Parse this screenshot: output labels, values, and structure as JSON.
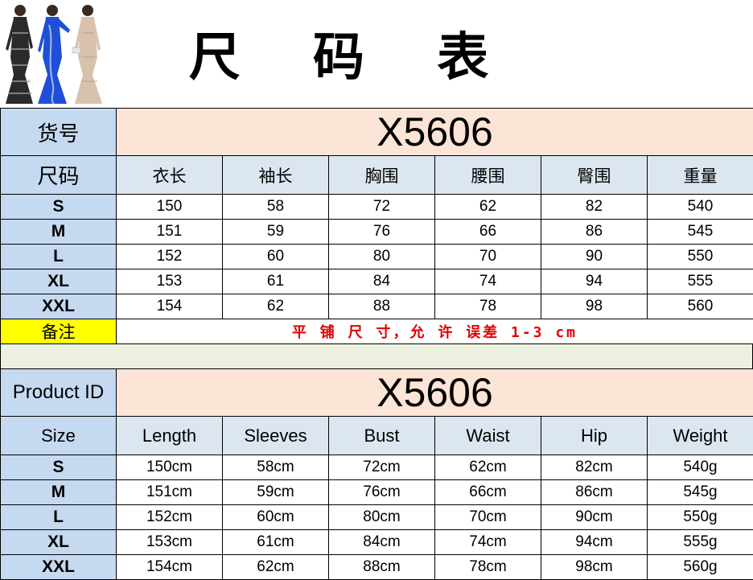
{
  "title": "尺 码 表",
  "note": {
    "label": "备注",
    "text": "平 铺 尺 寸，允 许 误差 1-3 cm"
  },
  "cn_table": {
    "id_label": "货号",
    "id_value": "X5606",
    "size_label": "尺码",
    "columns": [
      "衣长",
      "袖长",
      "胸围",
      "腰围",
      "臀围",
      "重量"
    ],
    "rows": [
      {
        "size": "S",
        "values": [
          "150",
          "58",
          "72",
          "62",
          "82",
          "540"
        ]
      },
      {
        "size": "M",
        "values": [
          "151",
          "59",
          "76",
          "66",
          "86",
          "545"
        ]
      },
      {
        "size": "L",
        "values": [
          "152",
          "60",
          "80",
          "70",
          "90",
          "550"
        ]
      },
      {
        "size": "XL",
        "values": [
          "153",
          "61",
          "84",
          "74",
          "94",
          "555"
        ]
      },
      {
        "size": "XXL",
        "values": [
          "154",
          "62",
          "88",
          "78",
          "98",
          "560"
        ]
      }
    ]
  },
  "en_table": {
    "id_label": "Product ID",
    "id_value": "X5606",
    "size_label": "Size",
    "columns": [
      "Length",
      "Sleeves",
      "Bust",
      "Waist",
      "Hip",
      "Weight"
    ],
    "rows": [
      {
        "size": "S",
        "values": [
          "150cm",
          "58cm",
          "72cm",
          "62cm",
          "82cm",
          "540g"
        ]
      },
      {
        "size": "M",
        "values": [
          "151cm",
          "59cm",
          "76cm",
          "66cm",
          "86cm",
          "545g"
        ]
      },
      {
        "size": "L",
        "values": [
          "152cm",
          "60cm",
          "80cm",
          "70cm",
          "90cm",
          "550g"
        ]
      },
      {
        "size": "XL",
        "values": [
          "153cm",
          "61cm",
          "84cm",
          "74cm",
          "94cm",
          "555g"
        ]
      },
      {
        "size": "XXL",
        "values": [
          "154cm",
          "62cm",
          "88cm",
          "78cm",
          "98cm",
          "560g"
        ]
      }
    ]
  },
  "colors": {
    "label_blue": "#c5d9f1",
    "header_blue": "#dce6f1",
    "peach": "#fce4d6",
    "note_yellow": "#ffff00",
    "note_red": "#e00000",
    "spacer_green": "#ebf1de",
    "dress_black": "#2b2b2b",
    "dress_blue": "#1f4fd6",
    "dress_nude": "#d9c2ad"
  }
}
